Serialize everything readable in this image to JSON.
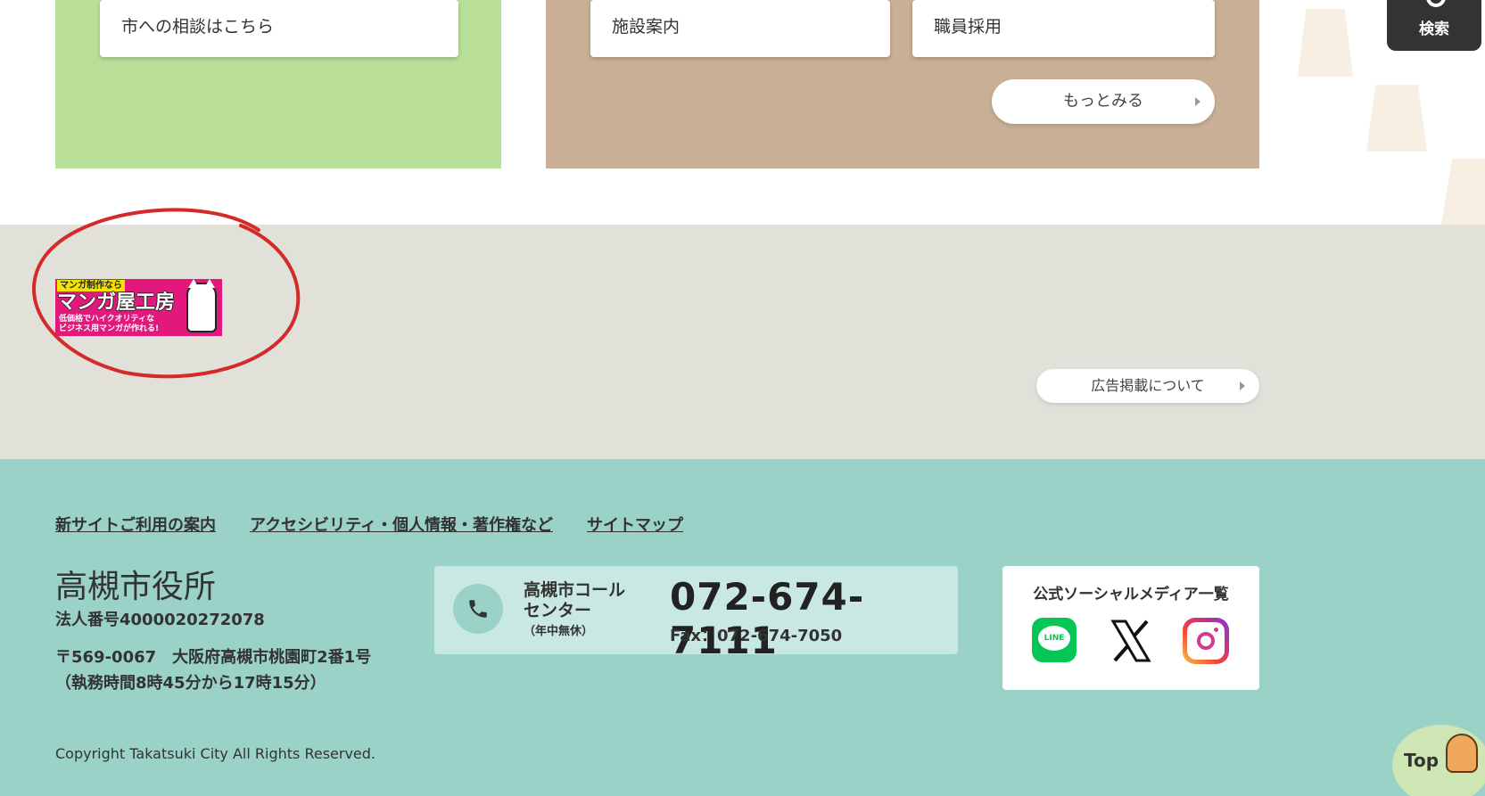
{
  "top": {
    "consult_link": "市への相談はこちら",
    "facility_link": "施設案内",
    "recruit_link": "職員採用",
    "more_button": "もっとみる",
    "search_button": "検索"
  },
  "ad": {
    "banner": {
      "line1": "マンガ制作なら",
      "line2": "マンガ屋工房",
      "line3": "低価格でハイクオリティな",
      "line4": "ビジネス用マンガが作れる!"
    },
    "about_button": "広告掲載について"
  },
  "footer": {
    "links": [
      "新サイトご利用の案内",
      "アクセシビリティ・個人情報・著作権など",
      "サイトマップ"
    ],
    "org_name": "高槻市役所",
    "corp_number": "法人番号4000020272078",
    "address": "〒569-0067　大阪府高槻市桃園町2番1号",
    "hours": "（執務時間8時45分から17時15分）",
    "call_center": {
      "name": "高槻市コールセンター",
      "sub": "（年中無休）",
      "tel": "072-674-7111",
      "fax": "Fax：072-674-7050"
    },
    "social": {
      "title": "公式ソーシャルメディア一覧",
      "line_label": "LINE"
    },
    "copyright": "Copyright Takatsuki City All Rights Reserved.",
    "top_button": "Top"
  },
  "colors": {
    "green_panel": "#b8de98",
    "tan_panel": "#c8af96",
    "ad_bg": "#e1e1da",
    "footer_bg": "#9ad2c8",
    "annotation_circle": "#d42a2a"
  }
}
